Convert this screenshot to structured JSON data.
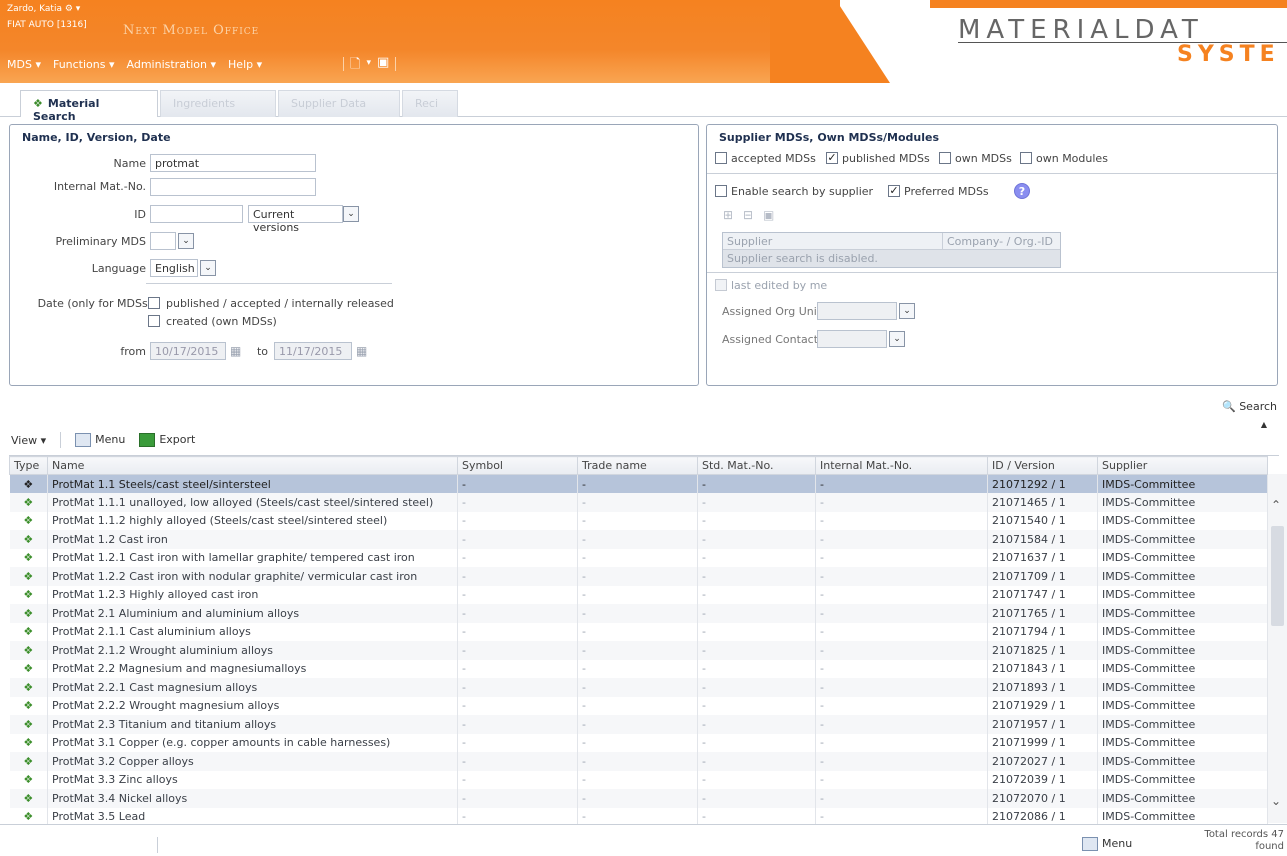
{
  "header": {
    "user": "Zardo, Katia",
    "company": "FIAT AUTO [1316]",
    "app_title": "Next Model Office",
    "menu": [
      "MDS ▾",
      "Functions ▾",
      "Administration ▾",
      "Help ▾"
    ],
    "logo_main": "MATERIALDAT",
    "logo_bold": "",
    "logo_sub": "SYSTE"
  },
  "tabs": {
    "active": "Material Search",
    "inactive": [
      "Ingredients",
      "Supplier Data",
      "Reci"
    ]
  },
  "left_panel": {
    "title": "Name, ID, Version, Date",
    "name_label": "Name",
    "name_value": "protmat",
    "internal_label": "Internal Mat.-No.",
    "internal_value": "",
    "id_label": "ID",
    "id_value": "",
    "versions_value": "Current versions",
    "preliminary_label": "Preliminary MDS",
    "preliminary_value": "",
    "language_label": "Language",
    "language_value": "English",
    "date_label": "Date (only for MDSs)",
    "date_opt1": "published / accepted / internally released",
    "date_opt2": "created (own MDSs)",
    "from_label": "from",
    "from_value": "10/17/2015",
    "to_label": "to",
    "to_value": "11/17/2015"
  },
  "right_panel": {
    "title": "Supplier MDSs, Own MDSs/Modules",
    "cb_accepted": "accepted MDSs",
    "cb_published": "published MDSs",
    "cb_own": "own MDSs",
    "cb_modules": "own Modules",
    "cb_enable": "Enable search by supplier",
    "cb_preferred": "Preferred MDSs",
    "help": "?",
    "col_supplier": "Supplier",
    "col_company": "Company- / Org.-ID",
    "supplier_disabled": "Supplier search is disabled.",
    "cb_last_edited": "last edited by me",
    "org_unit_label": "Assigned Org Unit",
    "contact_label": "Assigned Contact"
  },
  "search_button": "Search",
  "list_toolbar": {
    "view": "View ▾",
    "menu": "Menu",
    "export": "Export"
  },
  "columns": [
    "Type",
    "Name",
    "Symbol",
    "Trade name",
    "Std. Mat.-No.",
    "Internal Mat.-No.",
    "ID / Version",
    "Supplier"
  ],
  "rows": [
    {
      "name": "ProtMat 1.1 Steels/cast steel/sintersteel",
      "symbol": "-",
      "trade": "-",
      "std": "-",
      "internal": "-",
      "id": "21071292 / 1",
      "supplier": "IMDS-Committee"
    },
    {
      "name": "ProtMat 1.1.1 unalloyed, low alloyed (Steels/cast steel/sintered steel)",
      "symbol": "-",
      "trade": "-",
      "std": "-",
      "internal": "-",
      "id": "21071465 / 1",
      "supplier": "IMDS-Committee"
    },
    {
      "name": "ProtMat 1.1.2 highly alloyed (Steels/cast steel/sintered steel)",
      "symbol": "-",
      "trade": "-",
      "std": "-",
      "internal": "-",
      "id": "21071540 / 1",
      "supplier": "IMDS-Committee"
    },
    {
      "name": "ProtMat 1.2 Cast iron",
      "symbol": "-",
      "trade": "-",
      "std": "-",
      "internal": "-",
      "id": "21071584 / 1",
      "supplier": "IMDS-Committee"
    },
    {
      "name": "ProtMat 1.2.1 Cast iron with lamellar graphite/ tempered cast iron",
      "symbol": "-",
      "trade": "-",
      "std": "-",
      "internal": "-",
      "id": "21071637 / 1",
      "supplier": "IMDS-Committee"
    },
    {
      "name": "ProtMat 1.2.2 Cast iron with nodular graphite/ vermicular cast iron",
      "symbol": "-",
      "trade": "-",
      "std": "-",
      "internal": "-",
      "id": "21071709 / 1",
      "supplier": "IMDS-Committee"
    },
    {
      "name": "ProtMat 1.2.3 Highly alloyed cast iron",
      "symbol": "-",
      "trade": "-",
      "std": "-",
      "internal": "-",
      "id": "21071747 / 1",
      "supplier": "IMDS-Committee"
    },
    {
      "name": "ProtMat 2.1 Aluminium and aluminium alloys",
      "symbol": "-",
      "trade": "-",
      "std": "-",
      "internal": "-",
      "id": "21071765 / 1",
      "supplier": "IMDS-Committee"
    },
    {
      "name": "ProtMat 2.1.1 Cast aluminium alloys",
      "symbol": "-",
      "trade": "-",
      "std": "-",
      "internal": "-",
      "id": "21071794 / 1",
      "supplier": "IMDS-Committee"
    },
    {
      "name": "ProtMat 2.1.2 Wrought aluminium alloys",
      "symbol": "-",
      "trade": "-",
      "std": "-",
      "internal": "-",
      "id": "21071825 / 1",
      "supplier": "IMDS-Committee"
    },
    {
      "name": "ProtMat 2.2 Magnesium and magnesiumalloys",
      "symbol": "-",
      "trade": "-",
      "std": "-",
      "internal": "-",
      "id": "21071843 / 1",
      "supplier": "IMDS-Committee"
    },
    {
      "name": "ProtMat 2.2.1 Cast magnesium alloys",
      "symbol": "-",
      "trade": "-",
      "std": "-",
      "internal": "-",
      "id": "21071893 / 1",
      "supplier": "IMDS-Committee"
    },
    {
      "name": "ProtMat 2.2.2 Wrought magnesium alloys",
      "symbol": "-",
      "trade": "-",
      "std": "-",
      "internal": "-",
      "id": "21071929 / 1",
      "supplier": "IMDS-Committee"
    },
    {
      "name": "ProtMat 2.3 Titanium and titanium alloys",
      "symbol": "-",
      "trade": "-",
      "std": "-",
      "internal": "-",
      "id": "21071957 / 1",
      "supplier": "IMDS-Committee"
    },
    {
      "name": "ProtMat 3.1 Copper (e.g. copper amounts in cable harnesses)",
      "symbol": "-",
      "trade": "-",
      "std": "-",
      "internal": "-",
      "id": "21071999 / 1",
      "supplier": "IMDS-Committee"
    },
    {
      "name": "ProtMat 3.2 Copper alloys",
      "symbol": "-",
      "trade": "-",
      "std": "-",
      "internal": "-",
      "id": "21072027 / 1",
      "supplier": "IMDS-Committee"
    },
    {
      "name": "ProtMat 3.3 Zinc alloys",
      "symbol": "-",
      "trade": "-",
      "std": "-",
      "internal": "-",
      "id": "21072039 / 1",
      "supplier": "IMDS-Committee"
    },
    {
      "name": "ProtMat 3.4 Nickel alloys",
      "symbol": "-",
      "trade": "-",
      "std": "-",
      "internal": "-",
      "id": "21072070 / 1",
      "supplier": "IMDS-Committee"
    },
    {
      "name": "ProtMat 3.5 Lead",
      "symbol": "-",
      "trade": "-",
      "std": "-",
      "internal": "-",
      "id": "21072086 / 1",
      "supplier": "IMDS-Committee"
    }
  ],
  "footer": {
    "menu": "Menu",
    "total": "Total records 47 found"
  },
  "colors": {
    "brand_orange": "#f58220",
    "selected_row": "#b6c4da",
    "title_blue": "#1f3050"
  }
}
